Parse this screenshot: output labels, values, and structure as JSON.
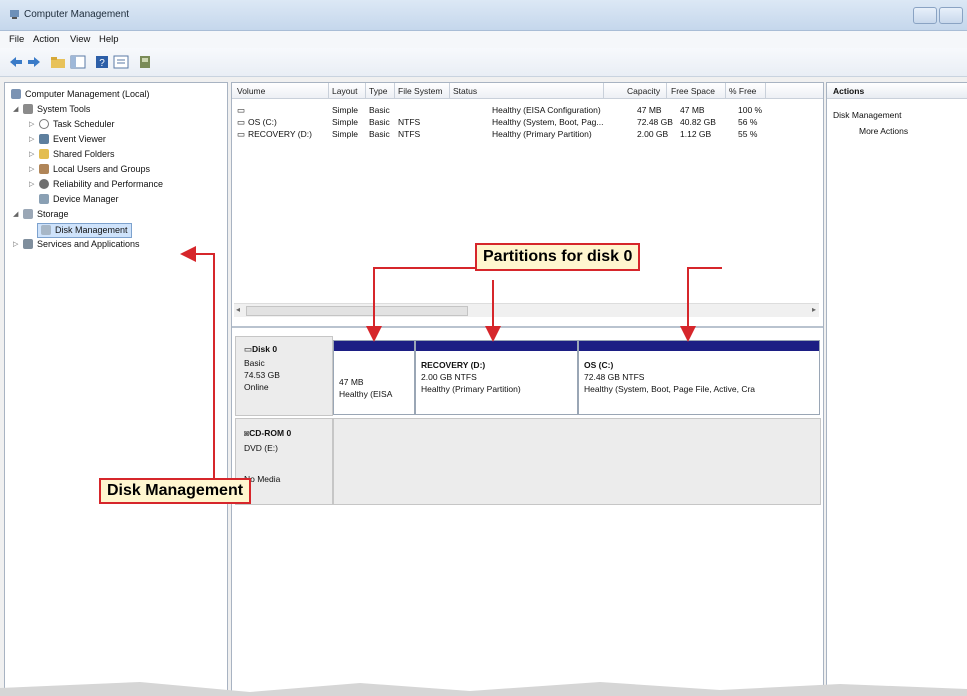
{
  "window": {
    "title": "Computer Management"
  },
  "menu": [
    "File",
    "Action",
    "View",
    "Help"
  ],
  "toolbar_icons": [
    "back-arrow-icon",
    "forward-arrow-icon",
    "up-folder-icon",
    "show-hide-tree-icon",
    "help-icon",
    "properties-icon",
    "console-icon"
  ],
  "tree": {
    "root": "Computer Management (Local)",
    "system_tools": "System Tools",
    "task_scheduler": "Task Scheduler",
    "event_viewer": "Event Viewer",
    "shared_folders": "Shared Folders",
    "local_users": "Local Users and Groups",
    "reliability": "Reliability and Performance",
    "device_manager": "Device Manager",
    "storage": "Storage",
    "disk_management": "Disk Management",
    "services": "Services and Applications"
  },
  "volumes": {
    "columns": [
      "Volume",
      "Layout",
      "Type",
      "File System",
      "Status",
      "Capacity",
      "Free Space",
      "% Free"
    ],
    "rows": [
      {
        "volume": "",
        "layout": "Simple",
        "type": "Basic",
        "fs": "",
        "status": "Healthy (EISA Configuration)",
        "capacity": "47 MB",
        "free": "47 MB",
        "pct": "100 %"
      },
      {
        "volume": "OS (C:)",
        "layout": "Simple",
        "type": "Basic",
        "fs": "NTFS",
        "status": "Healthy (System, Boot, Pag...",
        "capacity": "72.48 GB",
        "free": "40.82 GB",
        "pct": "56 %"
      },
      {
        "volume": "RECOVERY (D:)",
        "layout": "Simple",
        "type": "Basic",
        "fs": "NTFS",
        "status": "Healthy (Primary Partition)",
        "capacity": "2.00 GB",
        "free": "1.12 GB",
        "pct": "55 %"
      }
    ]
  },
  "disk0": {
    "name": "Disk 0",
    "type": "Basic",
    "size": "74.53 GB",
    "state": "Online",
    "partitions": [
      {
        "name": "",
        "size": "47 MB",
        "status": "Healthy (EISA"
      },
      {
        "name": "RECOVERY (D:)",
        "size": "2.00 GB NTFS",
        "status": "Healthy (Primary Partition)"
      },
      {
        "name": "OS (C:)",
        "size": "72.48 GB NTFS",
        "status": "Healthy (System, Boot, Page File, Active, Cra"
      }
    ]
  },
  "cdrom": {
    "name": "CD-ROM 0",
    "drive": "DVD (E:)",
    "media": "No Media"
  },
  "actions": {
    "header": "Actions",
    "section": "Disk Management",
    "more": "More Actions"
  },
  "callouts": {
    "partitions": "Partitions for disk 0",
    "disk_mgmt": "Disk Management"
  },
  "colors": {
    "partition_bar": "#1c1e84",
    "callout_border": "#d6262b",
    "callout_fill": "#fff6cf"
  }
}
